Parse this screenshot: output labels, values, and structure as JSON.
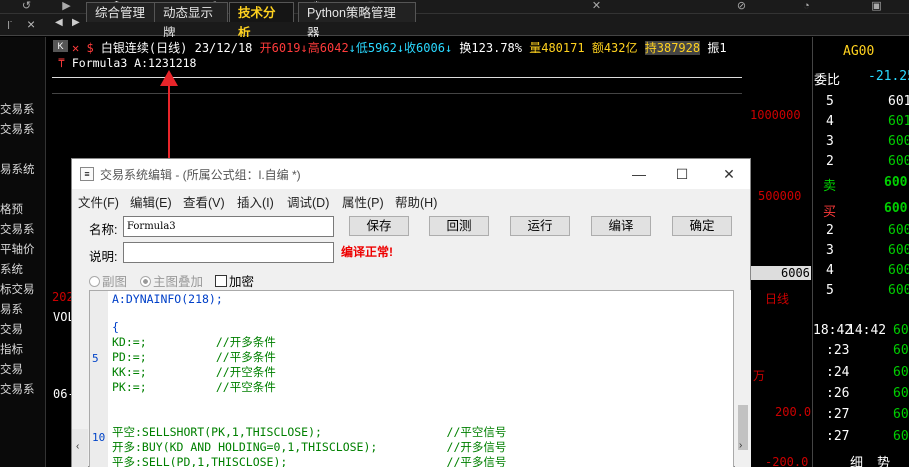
{
  "toolbar": {
    "icons": [
      "back-icon",
      "play-icon",
      "dollar-icon",
      "list-icon",
      "draw-icon",
      "arrow-icon",
      "gear-icon",
      "search-icon",
      "link-icon",
      "bell-icon",
      "window-icon"
    ],
    "dollar": "$"
  },
  "tabs": [
    {
      "label": "综合管理",
      "active": false
    },
    {
      "label": "动态显示牌",
      "active": false
    },
    {
      "label": "技术分析",
      "active": true
    },
    {
      "label": "Python策略管理器",
      "active": false
    }
  ],
  "sidebar": {
    "items": [
      "交易系",
      "交易系",
      "易系统",
      "格预",
      "交易系",
      "平轴价",
      "系统",
      "标交易",
      "易系",
      "交易",
      "指标",
      "交易",
      "交易系"
    ]
  },
  "quote": {
    "k": "K",
    "symbol": "白银连续(日线)",
    "date": "23/12/18",
    "open": "开6019",
    "high": "高6042",
    "low": "低5962",
    "close": "收6006",
    "turnover": "换123.78%",
    "volume": "量480171",
    "amount": "额432亿",
    "hold": "持387928",
    "amp": "振1"
  },
  "formula_line": "Formula3 A:1231218",
  "axis": {
    "y1": "1000000",
    "y2": "500000",
    "price_tag": "6006",
    "right_label": "日线",
    "r200": "200.0",
    "r200n": "-200.0",
    "ten": "万",
    "year": "202",
    "vol": "VOL",
    "date06": "06-"
  },
  "right_panel": {
    "code": "AG00",
    "ratio_label": "委比",
    "ratio_value": "-21.25",
    "sell_label": "卖",
    "buy_label": "买",
    "sell_rows": [
      [
        "5",
        "601"
      ],
      [
        "4",
        "601"
      ],
      [
        "3",
        "600"
      ],
      [
        "2",
        "600"
      ]
    ],
    "sell_one": "600",
    "buy_one": "600",
    "buy_rows": [
      [
        "2",
        "600"
      ],
      [
        "3",
        "600"
      ],
      [
        "4",
        "600"
      ],
      [
        "5",
        "600"
      ]
    ],
    "times": [
      [
        "18:42",
        "14:42",
        "60"
      ],
      [
        ":23",
        "",
        "60"
      ],
      [
        ":24",
        "",
        "60"
      ],
      [
        ":26",
        "",
        "60"
      ],
      [
        ":27",
        "",
        "60"
      ],
      [
        ":27",
        "",
        "60"
      ]
    ],
    "bottom": [
      "细",
      "势"
    ]
  },
  "dialog": {
    "title": "交易系统编辑 - (所属公式组：l.自编 *)",
    "menus": [
      "文件(F)",
      "编辑(E)",
      "查看(V)",
      "插入(I)",
      "调试(D)",
      "属性(P)",
      "帮助(H)"
    ],
    "name_label": "名称:",
    "name_value": "Formula3",
    "desc_label": "说明:",
    "desc_value": "",
    "buttons": [
      "保存",
      "回测",
      "运行",
      "编译",
      "确定"
    ],
    "status": "编译正常!",
    "radio_sub": "副图",
    "radio_main": "主图叠加",
    "check_encrypt": "加密",
    "gutter": [
      "5",
      "10"
    ],
    "code_lines": [
      {
        "text": "A:DYNAINFO(218);",
        "color": "blue"
      },
      {
        "text": "",
        "color": "black"
      },
      {
        "text": "{",
        "color": "blue"
      },
      {
        "text": "KD:=;          //开多条件",
        "color": "green"
      },
      {
        "text": "PD:=;          //平多条件",
        "color": "green"
      },
      {
        "text": "KK:=;          //开空条件",
        "color": "green"
      },
      {
        "text": "PK:=;          //平空条件",
        "color": "green"
      },
      {
        "text": "",
        "color": "black"
      },
      {
        "text": "",
        "color": "black"
      },
      {
        "text": "",
        "color": "black"
      },
      {
        "text": "平空:SELLSHORT(PK,1,THISCLOSE);                  //平空信号",
        "color": "green"
      },
      {
        "text": "开多:BUY(KD AND HOLDING=0,1,THISCLOSE);          //开多信号",
        "color": "green"
      },
      {
        "text": "平多:SELL(PD,1,THISCLOSE);                       //平多信号",
        "color": "green"
      }
    ]
  },
  "colors": {
    "accent": "#ffd21f",
    "up": "#ff3b3b",
    "down": "#2ad9ff",
    "green": "#00d000",
    "code_green": "#008000",
    "code_blue": "#0040c8"
  }
}
